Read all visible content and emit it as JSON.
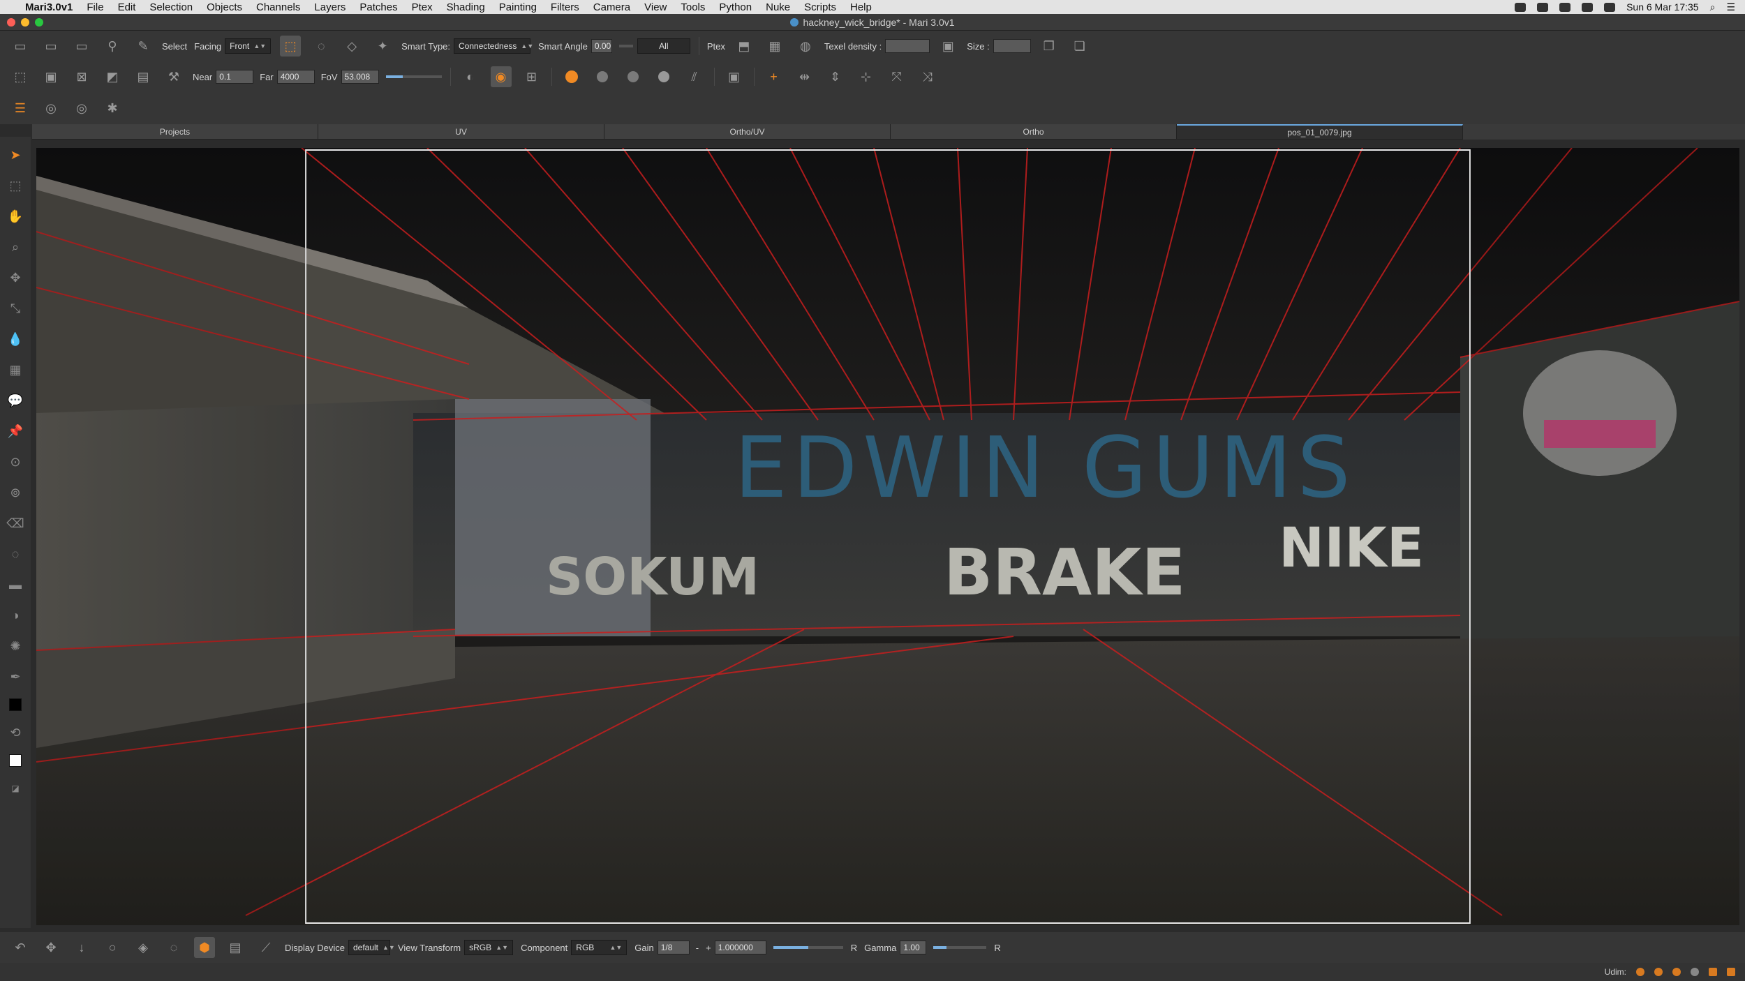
{
  "menubar": {
    "app_name": "Mari3.0v1",
    "menus": [
      "File",
      "Edit",
      "Selection",
      "Objects",
      "Channels",
      "Layers",
      "Patches",
      "Ptex",
      "Shading",
      "Painting",
      "Filters",
      "Camera",
      "View",
      "Tools",
      "Python",
      "Nuke",
      "Scripts",
      "Help"
    ],
    "clock": "Sun 6 Mar  17:35"
  },
  "window": {
    "title": "hackney_wick_bridge* - Mari 3.0v1"
  },
  "toolbar1": {
    "select_label": "Select",
    "facing_label": "Facing",
    "facing_value": "Front",
    "smart_type_label": "Smart Type:",
    "smart_type_value": "Connectedness",
    "smart_angle_label": "Smart Angle",
    "smart_angle_value": "0.00",
    "all_value": "All",
    "ptex_label": "Ptex",
    "texel_density_label": "Texel density :",
    "texel_density_value": "",
    "size_label": "Size :",
    "size_value": ""
  },
  "toolbar2": {
    "near_label": "Near",
    "near_value": "0.1",
    "far_label": "Far",
    "far_value": "4000",
    "fov_label": "FoV",
    "fov_value": "53.008",
    "fov_slider": 0.3
  },
  "tabs": [
    {
      "label": "Projects",
      "active": false
    },
    {
      "label": "UV",
      "active": false
    },
    {
      "label": "Ortho/UV",
      "active": false
    },
    {
      "label": "Ortho",
      "active": false
    },
    {
      "label": "pos_01_0079.jpg",
      "active": true
    }
  ],
  "viewport": {
    "graffiti_main": "EDWIN GUMS",
    "graffiti_secondary": [
      "BRAKE",
      "NIKE",
      "SOKUM"
    ]
  },
  "bottombar": {
    "display_device_label": "Display Device",
    "display_device_value": "default",
    "view_transform_label": "View Transform",
    "view_transform_value": "sRGB",
    "component_label": "Component",
    "component_value": "RGB",
    "gain_label": "Gain",
    "gain_value": "1/8",
    "gain_minus": "-",
    "gain_plus": "+",
    "gain_float": "1.000000",
    "gain_reset": "R",
    "gamma_label": "Gamma",
    "gamma_value": "1.00",
    "gamma_reset": "R",
    "gain_slider": 0.5,
    "gamma_slider": 0.25
  },
  "statusbar": {
    "udim_label": "Udim:"
  },
  "colors": {
    "accent": "#f08a24",
    "wireframe": "#c81e1e",
    "tab_active": "#6aa8e0"
  }
}
